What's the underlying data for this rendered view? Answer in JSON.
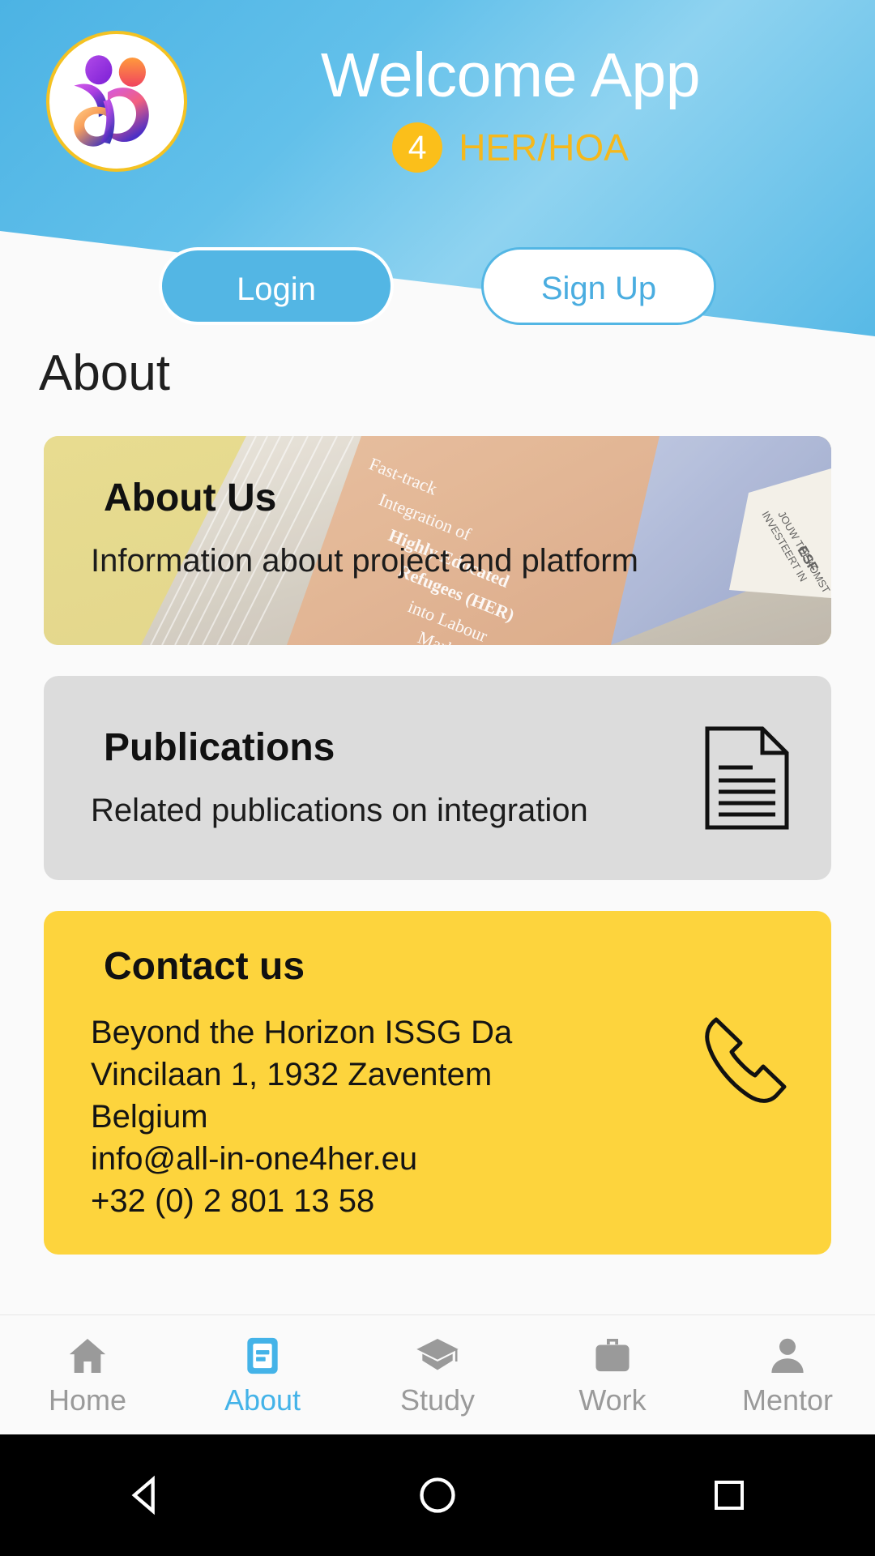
{
  "header": {
    "app_title": "Welcome App",
    "badge_count": "4",
    "subtitle": "HER/HOA",
    "logo_icon": "two-figures-logo",
    "bg_color": "#57b9e6",
    "accent_yellow": "#f5b81c"
  },
  "auth": {
    "login_label": "Login",
    "signup_label": "Sign Up"
  },
  "page": {
    "title": "About"
  },
  "cards": [
    {
      "id": "about-us",
      "title": "About Us",
      "subtitle": "Information about project and platform",
      "bg_color": "#e2d383",
      "photo_text": "Fast-track Integration of Highly Educated Refugees (HER) into Labour Market",
      "photo_badge": "INVESTEERT IN JOUW TOEKOMST ESF",
      "icon": ""
    },
    {
      "id": "publications",
      "title": "Publications",
      "subtitle": "Related publications on integration",
      "bg_color": "#dcdcdc",
      "icon": "document-icon"
    },
    {
      "id": "contact-us",
      "title": "Contact us",
      "subtitle": "",
      "bg_color": "#fdd43d",
      "icon": "phone-icon",
      "contact_lines": [
        "Beyond the Horizon ISSG Da",
        "Vincilaan 1, 1932 Zaventem",
        "Belgium",
        "info@all-in-one4her.eu",
        "+32 (0) 2 801 13 58"
      ]
    }
  ],
  "bottom_nav": {
    "active": "About",
    "active_color": "#44b3e8",
    "inactive_color": "#9a9a9a",
    "items": [
      {
        "label": "Home",
        "icon": "home-icon"
      },
      {
        "label": "About",
        "icon": "article-icon"
      },
      {
        "label": "Study",
        "icon": "graduation-cap-icon"
      },
      {
        "label": "Work",
        "icon": "briefcase-icon"
      },
      {
        "label": "Mentor",
        "icon": "person-icon"
      }
    ]
  },
  "system_bar": {
    "back": "back-triangle-icon",
    "home": "home-circle-icon",
    "recents": "recents-square-icon"
  }
}
